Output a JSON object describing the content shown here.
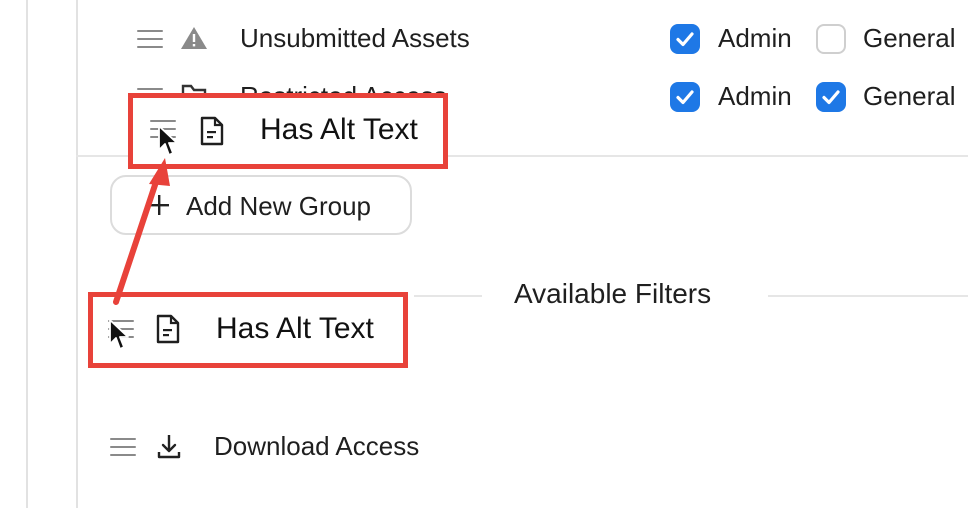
{
  "groups": {
    "rows": [
      {
        "label": "Unsubmitted Assets",
        "icon": "warning-icon",
        "admin_label": "Admin",
        "general_label": "General",
        "admin_checked": true,
        "general_checked": false
      },
      {
        "label": "Restricted Access",
        "icon": "folder-lock-icon",
        "admin_label": "Admin",
        "general_label": "General",
        "admin_checked": true,
        "general_checked": true
      }
    ],
    "dragging_item": {
      "label": "Has Alt Text",
      "icon": "document-icon"
    },
    "add_group_label": "Add New Group"
  },
  "available_filters": {
    "title": "Available Filters",
    "items": [
      {
        "label": "Has Alt Text",
        "icon": "document-icon"
      },
      {
        "label": "Download Access",
        "icon": "download-icon"
      }
    ]
  },
  "colors": {
    "checkbox_on": "#1e78e6",
    "highlight": "#e8423a"
  }
}
